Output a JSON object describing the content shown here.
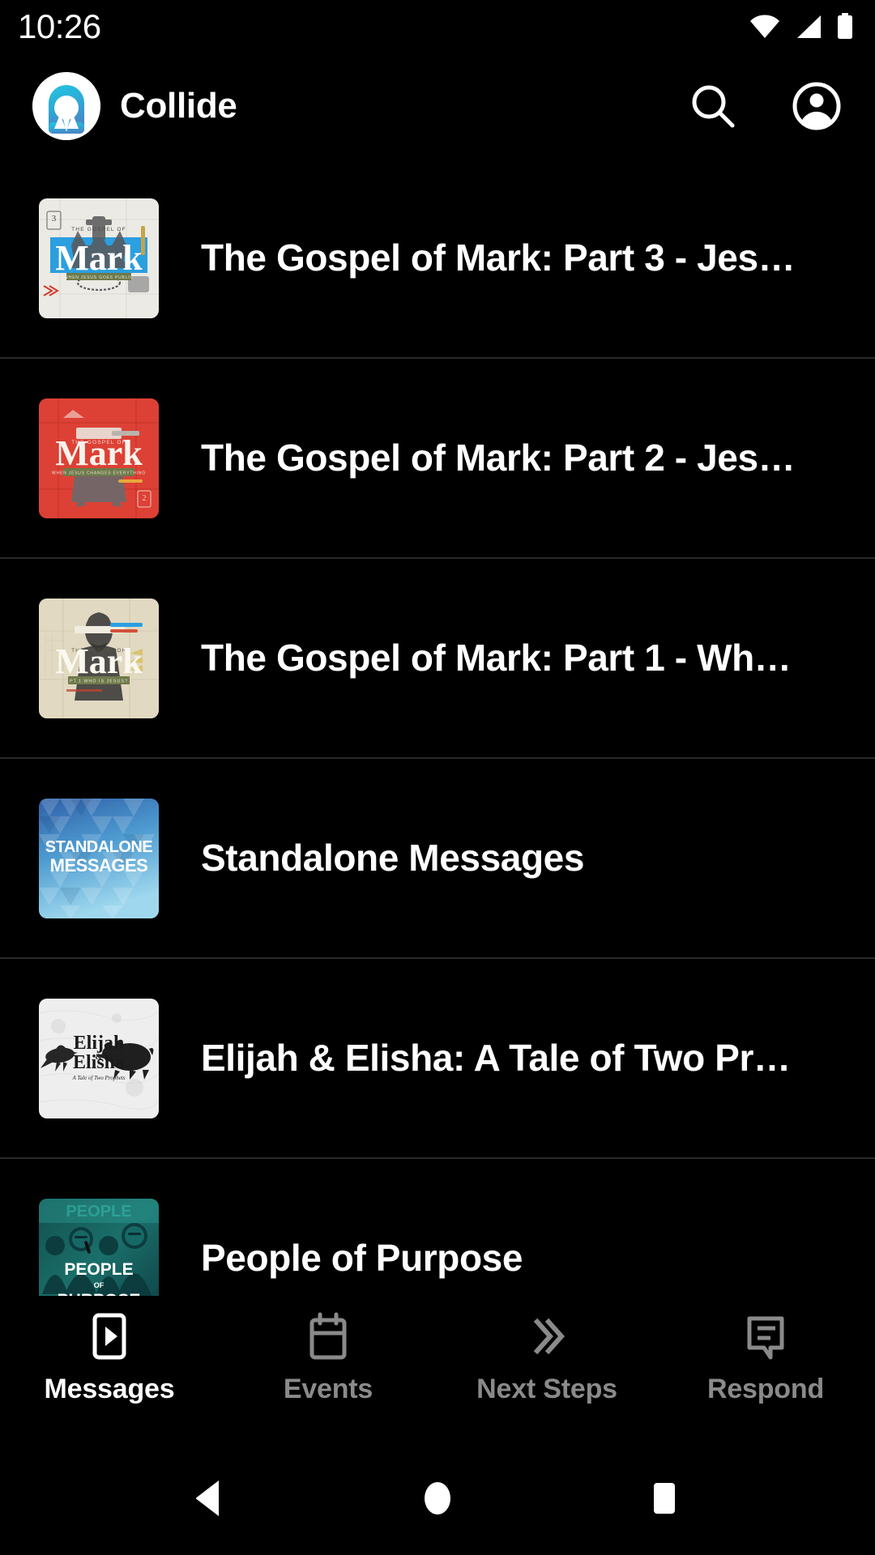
{
  "status_bar": {
    "clock": "10:26",
    "icons": [
      "wifi-icon",
      "cellular-signal-icon",
      "battery-icon"
    ]
  },
  "header": {
    "logo_icon": "collide-logo-icon",
    "title": "Collide",
    "actions": [
      {
        "icon": "search-icon",
        "label": "Search"
      },
      {
        "icon": "account-circle-icon",
        "label": "Account"
      }
    ]
  },
  "colors": {
    "background": "#000000",
    "text_primary": "#ffffff",
    "text_muted": "#8a8a8a",
    "divider": "#2a2a2a",
    "brand_cyan": "#27b7d8",
    "brand_blue": "#3d8fd0"
  },
  "list": {
    "items": [
      {
        "title": "The Gospel of Mark: Part 3 - Jes…",
        "thumb": "gospel-of-mark-part-3-artwork",
        "thumb_text": "Mark",
        "thumb_sub": "THE GOSPEL OF",
        "thumb_badge": "3"
      },
      {
        "title": "The Gospel of Mark: Part 2 - Jes…",
        "thumb": "gospel-of-mark-part-2-artwork",
        "thumb_text": "Mark",
        "thumb_sub": "THE GOSPEL OF",
        "thumb_badge": "2"
      },
      {
        "title": "The Gospel of Mark: Part 1 - Wh…",
        "thumb": "gospel-of-mark-part-1-artwork",
        "thumb_text": "Mark",
        "thumb_sub": "THE GOSPEL OF",
        "thumb_badge": "PT.1 WHO IS JESUS?"
      },
      {
        "title": "Standalone Messages",
        "thumb": "standalone-messages-artwork",
        "thumb_text": "STANDALONE",
        "thumb_sub": "MESSAGES",
        "thumb_badge": ""
      },
      {
        "title": "Elijah & Elisha: A Tale of Two Pr…",
        "thumb": "elijah-and-elisha-artwork",
        "thumb_text": "Elijah",
        "thumb_sub": "Elisha",
        "thumb_badge": "A Tale of Two Prophets"
      },
      {
        "title": "People of Purpose",
        "thumb": "people-of-purpose-artwork",
        "thumb_text": "PEOPLE",
        "thumb_sub": "PURPOSE",
        "thumb_badge": "OF"
      }
    ]
  },
  "bottom_nav": {
    "tabs": [
      {
        "label": "Messages",
        "icon": "messages-play-icon",
        "active": true
      },
      {
        "label": "Events",
        "icon": "calendar-icon",
        "active": false
      },
      {
        "label": "Next Steps",
        "icon": "double-chevron-icon",
        "active": false
      },
      {
        "label": "Respond",
        "icon": "chat-bubble-icon",
        "active": false
      }
    ]
  },
  "system_nav": {
    "buttons": [
      {
        "name": "back-button",
        "icon": "triangle-back-icon"
      },
      {
        "name": "home-button",
        "icon": "circle-home-icon"
      },
      {
        "name": "recents-button",
        "icon": "square-recents-icon"
      }
    ]
  }
}
